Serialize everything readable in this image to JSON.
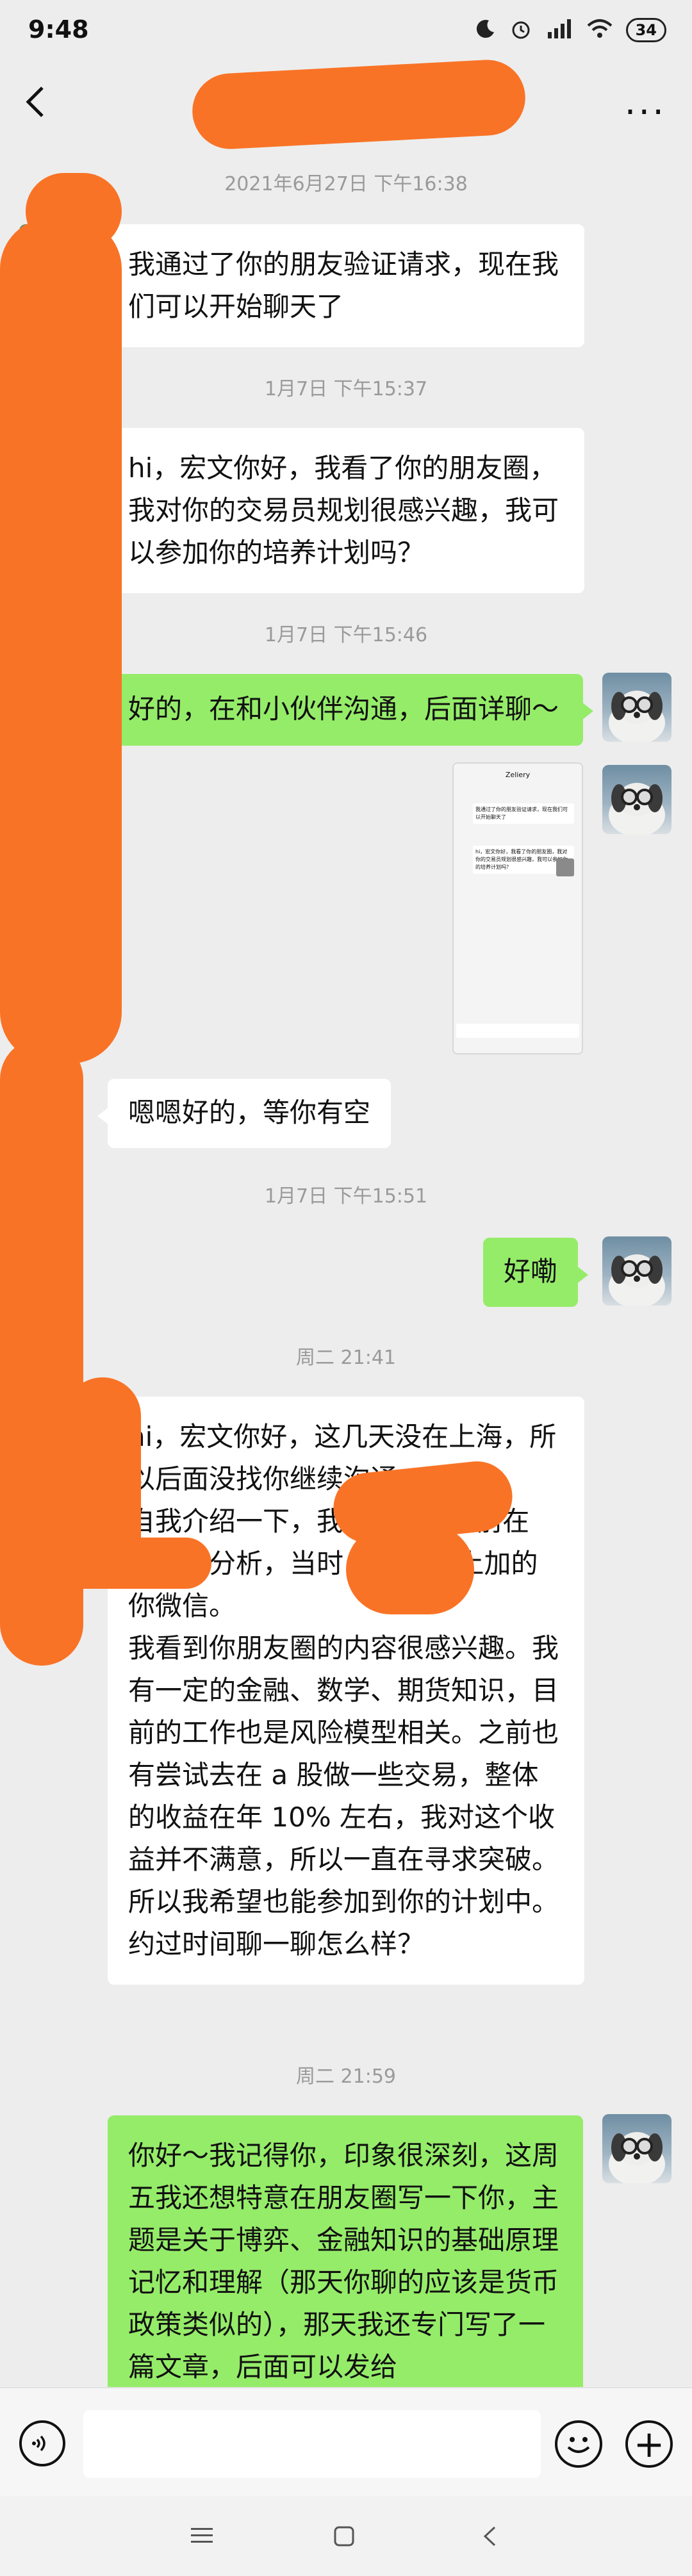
{
  "status_bar": {
    "time": "9:48",
    "battery": "34"
  },
  "header": {
    "title": "",
    "more": "..."
  },
  "messages": [
    {
      "type": "time",
      "text": "2021年6月27日 下午16:38"
    },
    {
      "type": "in",
      "text": "我通过了你的朋友验证请求，现在我们可以开始聊天了"
    },
    {
      "type": "time",
      "text": "1月7日 下午15:37"
    },
    {
      "type": "in",
      "text": "hi，宏文你好，我看了你的朋友圈，我对你的交易员规划很感兴趣，我可以参加你的培养计划吗？"
    },
    {
      "type": "time",
      "text": "1月7日 下午15:46"
    },
    {
      "type": "out",
      "text": "好的，在和小伙伴沟通，后面详聊～"
    },
    {
      "type": "out_image"
    },
    {
      "type": "in",
      "text": "嗯嗯好的，等你有空"
    },
    {
      "type": "time",
      "text": "1月7日 下午15:51"
    },
    {
      "type": "out",
      "text": "好嘞"
    },
    {
      "type": "time",
      "text": "周二 21:41"
    },
    {
      "type": "in",
      "text": "hi，宏文你好，这几天没在上海，所以后面没找你继续沟通。\n自我介绍一下，我叫      ，目前在      做数据分析，当时       饭局上加的你微信。\n我看到你朋友圈的内容很感兴趣。我有一定的金融、数学、期货知识，目前的工作也是风险模型相关。之前也有尝试去在 a 股做一些交易，整体的收益在年 10% 左右，我对这个收益并不满意，所以一直在寻求突破。所以我希望也能参加到你的计划中。\n约过时间聊一聊怎么样？"
    },
    {
      "type": "time",
      "text": "周二 21:59"
    },
    {
      "type": "out",
      "text": "你好～我记得你，印象很深刻，这周五我还想特意在朋友圈写一下你，主题是关于博弈、金融知识的基础原理记忆和理解（那天你聊的应该是货币政策类似的），那天我还专门写了一篇文章，后面可以发给"
    }
  ],
  "thumbnail": {
    "title": "Zeliery",
    "msg1": "我通过了你的朋友验证请求，现在我们可以开始聊天了",
    "msg2": "hi，宏文你好，我看了你的朋友圈，我对你的交易员规划很感兴趣，我可以参加你的培养计划吗？"
  },
  "input_bar": {
    "placeholder": "",
    "plus": "+"
  }
}
